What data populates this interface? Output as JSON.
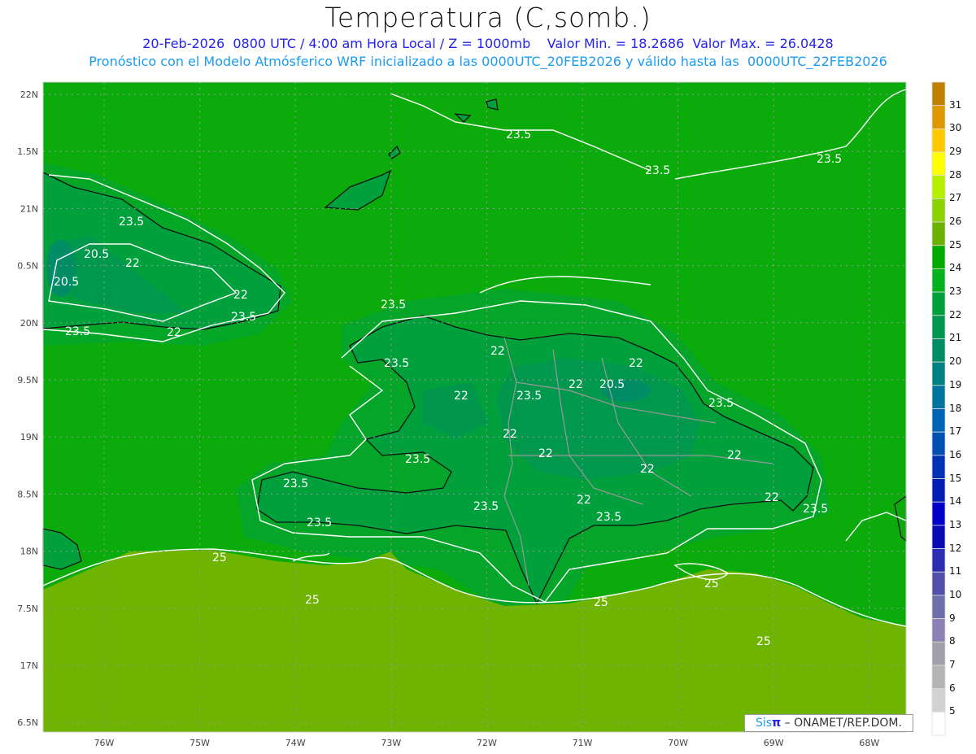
{
  "header": {
    "title": "Temperatura (C,somb.)",
    "subtitle": "20-Feb-2026  0800 UTC / 4:00 am Hora Local / Z = 1000mb    Valor Min. = 18.2686  Valor Max. = 26.0428",
    "model_info": "Pronóstico con el Modelo Atmósferico WRF inicializado a las 0000UTC_20FEB2026 y válido hasta las  0000UTC_22FEB2026"
  },
  "axes": {
    "lon_labels": [
      "76W",
      "75W",
      "74W",
      "73W",
      "72W",
      "71W",
      "70W",
      "69W",
      "68W"
    ],
    "lat_labels": [
      "22N",
      "1.5N",
      "21N",
      "0.5N",
      "20N",
      "9.5N",
      "19N",
      "8.5N",
      "18N",
      "7.5N",
      "17N",
      "6.5N"
    ]
  },
  "contour_labels": [
    "23.5",
    "23.5",
    "23.5",
    "23.5",
    "20.5",
    "20.5",
    "22",
    "22",
    "23.5",
    "22",
    "23.5",
    "23.5",
    "22",
    "22",
    "22",
    "20.5",
    "23.5",
    "22",
    "23.5",
    "22",
    "22",
    "23.5",
    "22",
    "22",
    "22",
    "23.5",
    "23.5",
    "23.5",
    "23.5",
    "23.5",
    "22",
    "23.5",
    "25",
    "25",
    "25",
    "25",
    "25"
  ],
  "colorbar": {
    "labels": [
      "31",
      "30",
      "29",
      "28",
      "27",
      "26",
      "25",
      "24",
      "23",
      "22",
      "21",
      "20",
      "19",
      "18",
      "17",
      "16",
      "15",
      "14",
      "13",
      "12",
      "11",
      "10",
      "9",
      "8",
      "7",
      "6",
      "5"
    ],
    "colors": [
      "#c08000",
      "#e09800",
      "#ffc800",
      "#ffff00",
      "#b4f000",
      "#8cd200",
      "#6cb000",
      "#00aa00",
      "#00b31e",
      "#00a03c",
      "#009650",
      "#008c64",
      "#008080",
      "#00749c",
      "#0064b4",
      "#0050b4",
      "#0032b4",
      "#001eb4",
      "#0000c8",
      "#0a0ab4",
      "#2d2db4",
      "#5050aa",
      "#6e6eaa",
      "#8c80b4",
      "#a0a0aa",
      "#b4b4b4",
      "#d2d2d2",
      "#ffffff"
    ]
  },
  "credit": {
    "brand_a": "Sis",
    "brand_b": "π",
    "text": " –  ONAMET/REP.DOM."
  }
}
